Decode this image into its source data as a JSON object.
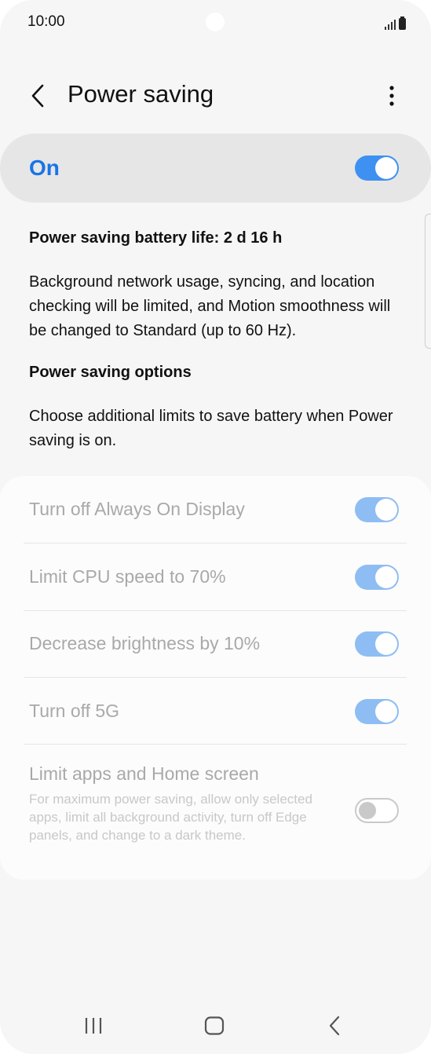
{
  "status_bar": {
    "time": "10:00",
    "icons": [
      "signal-icon",
      "battery-icon"
    ]
  },
  "header": {
    "title": "Power saving",
    "back_icon": "chevron-left-icon",
    "more_icon": "more-vertical-icon"
  },
  "master_switch": {
    "label": "On",
    "state": "on"
  },
  "info": {
    "battery_life": "Power saving battery life: 2 d 16 h",
    "description": "Background network usage, syncing, and location checking will be limited, and Motion smoothness will be changed to Standard (up to 60 Hz)."
  },
  "options": {
    "title": "Power saving options",
    "description": "Choose additional limits to save battery when Power saving is on.",
    "items": [
      {
        "label": "Turn off Always On Display",
        "state": "on"
      },
      {
        "label": "Limit CPU speed to 70%",
        "state": "on"
      },
      {
        "label": "Decrease brightness by 10%",
        "state": "on"
      },
      {
        "label": "Turn off 5G",
        "state": "on"
      },
      {
        "label": "Limit apps and Home screen",
        "sublabel": "For maximum power saving, allow only selected apps, limit all background activity, turn off Edge panels, and change to a dark theme.",
        "state": "off"
      }
    ]
  },
  "nav_bar": {
    "icons": [
      "recents-icon",
      "home-icon",
      "back-icon"
    ]
  },
  "colors": {
    "accent": "#3e91f0",
    "accent_text": "#1a73e8",
    "disabled_text": "#a9a9a9"
  }
}
